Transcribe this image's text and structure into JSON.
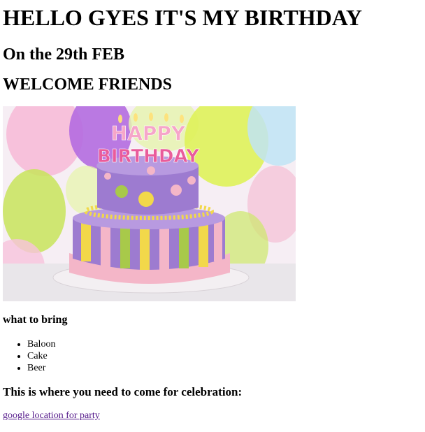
{
  "header": {
    "title": "HELLO GYES IT'S MY BIRTHDAY",
    "date_line": "On the 29th FEB",
    "welcome_line": "WELCOME FRIENDS"
  },
  "image": {
    "cake_topper_line1": "HAPPY",
    "cake_topper_line2": "BIRTHDAY"
  },
  "bring": {
    "heading": "what to bring",
    "items": [
      "Baloon",
      "Cake",
      "Beer"
    ]
  },
  "location": {
    "heading": "This is where you need to come for celebration:",
    "link_text": "google location for party"
  },
  "colors": {
    "link_visited": "#551a8b",
    "cake_purple": "#9d7bd0",
    "cake_yellow": "#f2d84a",
    "cake_green": "#a8c94a",
    "ribbon_pink": "#f4b6c8"
  }
}
